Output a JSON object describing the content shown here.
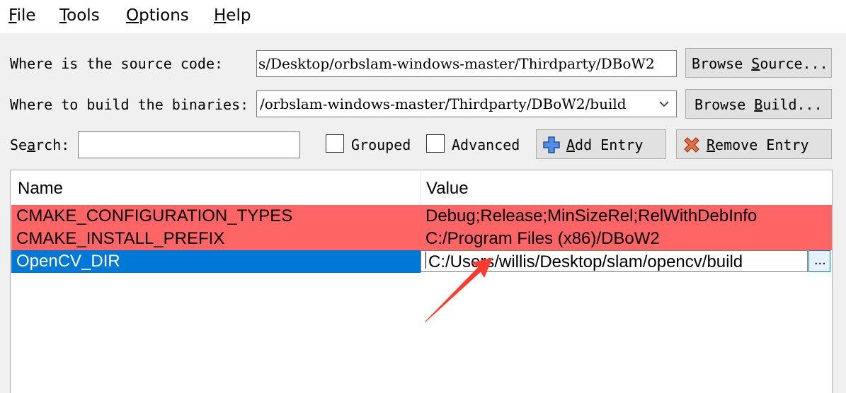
{
  "menu": {
    "file": {
      "mnemonic": "F",
      "rest": "ile"
    },
    "tools": {
      "mnemonic": "T",
      "rest": "ools"
    },
    "options": {
      "mnemonic": "O",
      "rest": "ptions"
    },
    "help": {
      "mnemonic": "H",
      "rest": "elp"
    }
  },
  "source": {
    "label": "Where is the source code:",
    "value": "s/Desktop/orbslam-windows-master/Thirdparty/DBoW2",
    "browse_pre": "Browse ",
    "browse_mnemonic": "S",
    "browse_post": "ource..."
  },
  "build": {
    "label": "Where to build the binaries:",
    "value": "/orbslam-windows-master/Thirdparty/DBoW2/build",
    "browse_pre": "Browse ",
    "browse_mnemonic": "B",
    "browse_post": "uild..."
  },
  "search": {
    "label_pre": "Se",
    "label_mnemonic": "a",
    "label_post": "rch:",
    "value": ""
  },
  "options": {
    "grouped_label": "Grouped",
    "grouped_checked": false,
    "advanced_label": "Advanced",
    "advanced_checked": false
  },
  "actions": {
    "add_mnemonic": "A",
    "add_rest": "dd Entry",
    "remove_mnemonic": "R",
    "remove_rest": "emove Entry"
  },
  "table": {
    "headers": [
      "Name",
      "Value"
    ],
    "rows": [
      {
        "name": "CMAKE_CONFIGURATION_TYPES",
        "value": "Debug;Release;MinSizeRel;RelWithDebInfo",
        "state": "new"
      },
      {
        "name": "CMAKE_INSTALL_PREFIX",
        "value": "C:/Program Files (x86)/DBoW2",
        "state": "new"
      },
      {
        "name": "OpenCV_DIR",
        "value": "C:/Users/willis/Desktop/slam/opencv/build",
        "state": "editing"
      }
    ],
    "ellipsis": "..."
  },
  "colors": {
    "new_entry": "#ff6565",
    "selected": "#0078d7",
    "annotation_arrow": "#ff3b2f"
  }
}
